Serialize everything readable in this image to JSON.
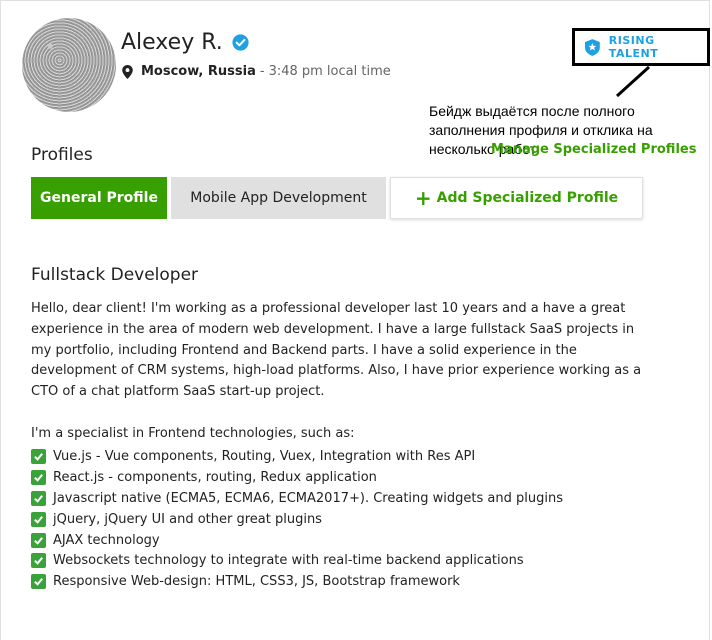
{
  "profile": {
    "name": "Alexey R.",
    "city": "Moscow, Russia",
    "separator": "-",
    "local_time": "3:48 pm local time"
  },
  "badge": {
    "label": "RISING TALENT",
    "color": "#1fa0e0"
  },
  "annotation": {
    "text": "Бейдж выдаётся после полного заполнения профиля и отклика на несколько работ"
  },
  "manage_link": "Manage Specialized Profiles",
  "profiles_section": {
    "heading": "Profiles",
    "tabs": [
      {
        "label": "General Profile"
      },
      {
        "label": "Mobile App Development"
      },
      {
        "label": "Add Specialized Profile"
      }
    ]
  },
  "overview": {
    "title": "Fullstack Developer",
    "paragraph": "Hello, dear client! I'm working as a professional developer last 10 years and a have a great experience in the area of modern web development. I have a large fullstack SaaS projects in my portfolio, including Frontend and Backend parts. I have a solid experience in the development of CRM systems, high-load platforms. Also, I have prior experience working as a CTO of a chat platform SaaS start-up project.",
    "specialist_intro": "I'm a specialist in Frontend technologies, such as:",
    "skills": [
      "Vue.js - Vue components, Routing, Vuex, Integration with Res API",
      "React.js - components, routing, Redux application",
      "Javascript native (ECMA5, ECMA6, ECMA2017+). Creating widgets and plugins",
      "jQuery, jQuery UI and other great plugins",
      "AJAX technology",
      "Websockets technology to integrate with real-time backend applications",
      "Responsive Web-design: HTML, CSS3, JS, Bootstrap framework"
    ]
  },
  "colors": {
    "accent_green": "#37a000",
    "verified_blue": "#1fa0e0"
  },
  "icons": [
    "verified-icon",
    "location-pin-icon",
    "shield-star-icon",
    "plus-icon",
    "checkmark-icon"
  ]
}
